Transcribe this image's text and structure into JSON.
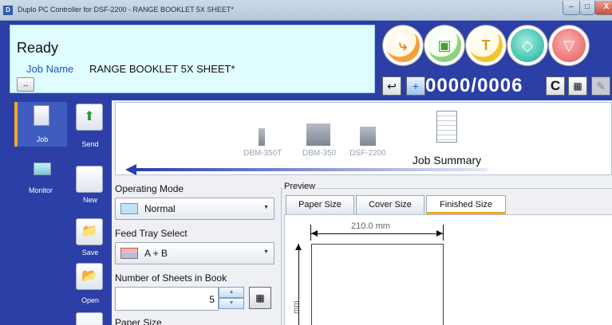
{
  "window": {
    "title": "Duplo PC Controller for DSF-2200 - RANGE BOOKLET 5X SHEET*",
    "controls": {
      "minimize": "–",
      "maximize": "□",
      "close": "X"
    }
  },
  "status": {
    "state": "Ready",
    "job_label": "Job Name",
    "job_name": "RANGE BOOKLET 5X SHEET*"
  },
  "counter": {
    "current": "0000",
    "separator": "/",
    "total": "0006"
  },
  "buttons": {
    "clear": "C",
    "circle_t": "T"
  },
  "nav": {
    "job": "Job",
    "monitor": "Monitor"
  },
  "tools": {
    "send": "Send",
    "new": "New",
    "save": "Save",
    "open": "Open"
  },
  "devices": [
    {
      "label": "DBM-350T"
    },
    {
      "label": "DBM-350"
    },
    {
      "label": "DSF-2200"
    }
  ],
  "job_summary": "Job Summary",
  "form": {
    "operating_mode_label": "Operating Mode",
    "operating_mode_value": "Normal",
    "feed_tray_label": "Feed Tray Select",
    "feed_tray_value": "A + B",
    "sheets_label": "Number of Sheets in Book",
    "sheets_value": "5",
    "paper_size_label": "Paper Size"
  },
  "preview": {
    "title": "Preview",
    "tabs": [
      {
        "label": "Paper Size"
      },
      {
        "label": "Cover Size"
      },
      {
        "label": "Finished Size",
        "active": true
      }
    ],
    "width_label": "210.0 mm",
    "height_label": "mm"
  },
  "colors": {
    "header_blue": "#2c3fa6",
    "status_panel": "#dffcff",
    "accent_orange": "#f5a623"
  }
}
